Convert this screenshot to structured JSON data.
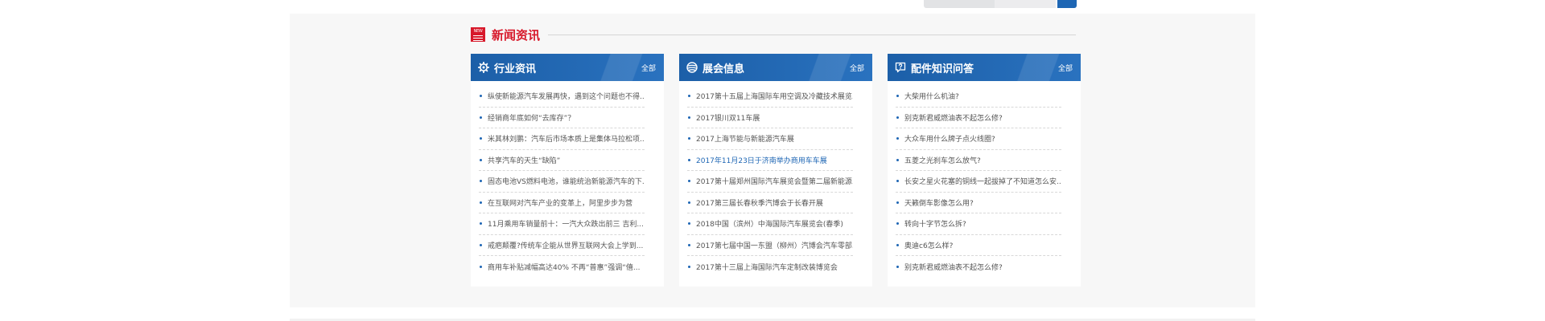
{
  "section": {
    "badge_top": "NEW",
    "title": "新闻资讯"
  },
  "colors": {
    "accent_red": "#d7182a",
    "header_blue": "#1e66b4",
    "link_active": "#1e66b4",
    "panel_bg": "#f7f7f7"
  },
  "cards": [
    {
      "icon": "gear-icon",
      "title": "行业资讯",
      "more": "全部",
      "items": [
        "纵使新能源汽车发展再快，遇到这个问题也不得...",
        "经销商年底如何“去库存”？",
        "米其林刘鹏：汽车后市场本质上是集体马拉松项...",
        "共享汽车的天生“缺陷”",
        "固态电池VS燃料电池，谁能统治新能源汽车的下...",
        "在互联网对汽车产业的变革上，阿里步步为营",
        "11月乘用车销量前十：一汽大众跌出前三 吉利...",
        "戒疤颠覆?传统车企能从世界互联网大会上学到...",
        "商用车补贴减幅高达40% 不再“普惠”强调“僖..."
      ]
    },
    {
      "icon": "globe-icon",
      "title": "展会信息",
      "more": "全部",
      "items": [
        "2017第十五届上海国际车用空调及冷藏技术展览...",
        "2017银川双11车展",
        "2017上海节能与新能源汽车展",
        "2017年11月23日于济南举办商用车车展",
        "2017第十届郑州国际汽车展览会暨第二届新能源...",
        "2017第三届长春秋季汽博会于长春开展",
        "2018中国（滨州）中海国际汽车展览会(春季)",
        "2017第七届中国一东盟（柳州）汽博会汽车零部...",
        "2017第十三届上海国际汽车定制改装博览会"
      ],
      "active_index": 3
    },
    {
      "icon": "question-icon",
      "title": "配件知识问答",
      "more": "全部",
      "items": [
        "大柴用什么机油?",
        "别克新君威燃油表不起怎么修?",
        "大众车用什么牌子点火线圈?",
        "五菱之光刹车怎么放气?",
        "长安之星火花塞的铜线一起拔掉了不知道怎么安...",
        "天籁倒车影像怎么用?",
        "转向十字节怎么拆?",
        "奥迪c6怎么样?",
        "别克新君威燃油表不起怎么修?"
      ]
    }
  ]
}
